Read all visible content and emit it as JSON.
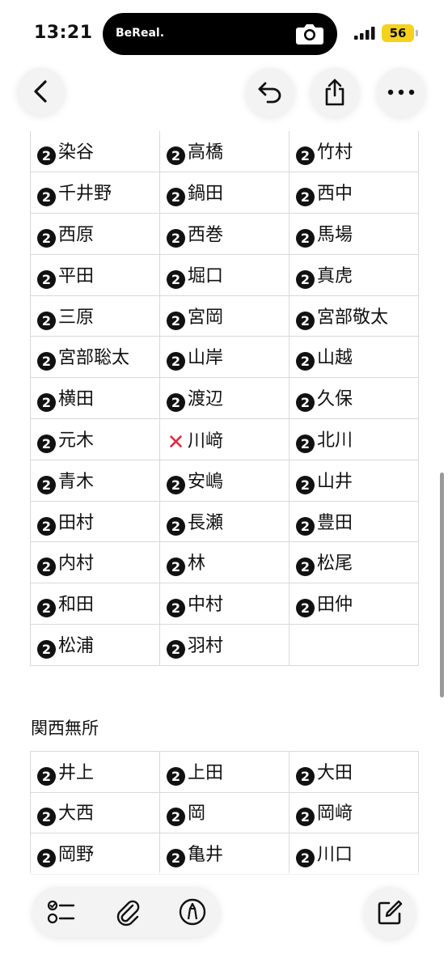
{
  "status_bar": {
    "time": "13:21",
    "island_label": "BeReal.",
    "battery": "56"
  },
  "icons": {
    "back": "chevron-left-icon",
    "undo": "undo-icon",
    "share": "share-icon",
    "more": "ellipsis-icon",
    "checklist": "checklist-icon",
    "attach": "paperclip-icon",
    "markup": "pen-markup-icon",
    "compose": "compose-icon"
  },
  "marks": {
    "two": "❷",
    "x": "✕"
  },
  "table1": {
    "rows": [
      [
        {
          "mark": "two",
          "name": "染谷"
        },
        {
          "mark": "two",
          "name": "高橋"
        },
        {
          "mark": "two",
          "name": "竹村"
        }
      ],
      [
        {
          "mark": "two",
          "name": "千井野"
        },
        {
          "mark": "two",
          "name": "鍋田"
        },
        {
          "mark": "two",
          "name": "西中"
        }
      ],
      [
        {
          "mark": "two",
          "name": "西原"
        },
        {
          "mark": "two",
          "name": "西巻"
        },
        {
          "mark": "two",
          "name": "馬場"
        }
      ],
      [
        {
          "mark": "two",
          "name": "平田"
        },
        {
          "mark": "two",
          "name": "堀口"
        },
        {
          "mark": "two",
          "name": "真虎"
        }
      ],
      [
        {
          "mark": "two",
          "name": "三原"
        },
        {
          "mark": "two",
          "name": "宮岡"
        },
        {
          "mark": "two",
          "name": "宮部敬太"
        }
      ],
      [
        {
          "mark": "two",
          "name": "宮部聡太"
        },
        {
          "mark": "two",
          "name": "山岸"
        },
        {
          "mark": "two",
          "name": "山越"
        }
      ],
      [
        {
          "mark": "two",
          "name": "横田"
        },
        {
          "mark": "two",
          "name": "渡辺"
        },
        {
          "mark": "two",
          "name": "久保"
        }
      ],
      [
        {
          "mark": "two",
          "name": "元木"
        },
        {
          "mark": "x",
          "name": "川﨑"
        },
        {
          "mark": "two",
          "name": "北川"
        }
      ],
      [
        {
          "mark": "two",
          "name": "青木"
        },
        {
          "mark": "two",
          "name": "安嶋"
        },
        {
          "mark": "two",
          "name": "山井"
        }
      ],
      [
        {
          "mark": "two",
          "name": "田村"
        },
        {
          "mark": "two",
          "name": "長瀬"
        },
        {
          "mark": "two",
          "name": "豊田"
        }
      ],
      [
        {
          "mark": "two",
          "name": "内村"
        },
        {
          "mark": "two",
          "name": "林"
        },
        {
          "mark": "two",
          "name": "松尾"
        }
      ],
      [
        {
          "mark": "two",
          "name": "和田"
        },
        {
          "mark": "two",
          "name": "中村"
        },
        {
          "mark": "two",
          "name": "田仲"
        }
      ],
      [
        {
          "mark": "two",
          "name": "松浦"
        },
        {
          "mark": "two",
          "name": "羽村"
        },
        {
          "mark": "",
          "name": ""
        }
      ]
    ]
  },
  "section2": {
    "heading": "関西無所",
    "rows": [
      [
        {
          "mark": "two",
          "name": "井上"
        },
        {
          "mark": "two",
          "name": "上田"
        },
        {
          "mark": "two",
          "name": "大田"
        }
      ],
      [
        {
          "mark": "two",
          "name": "大西"
        },
        {
          "mark": "two",
          "name": "岡"
        },
        {
          "mark": "two",
          "name": "岡﨑"
        }
      ],
      [
        {
          "mark": "two",
          "name": "岡野"
        },
        {
          "mark": "two",
          "name": "亀井"
        },
        {
          "mark": "two",
          "name": "川口"
        }
      ]
    ]
  }
}
